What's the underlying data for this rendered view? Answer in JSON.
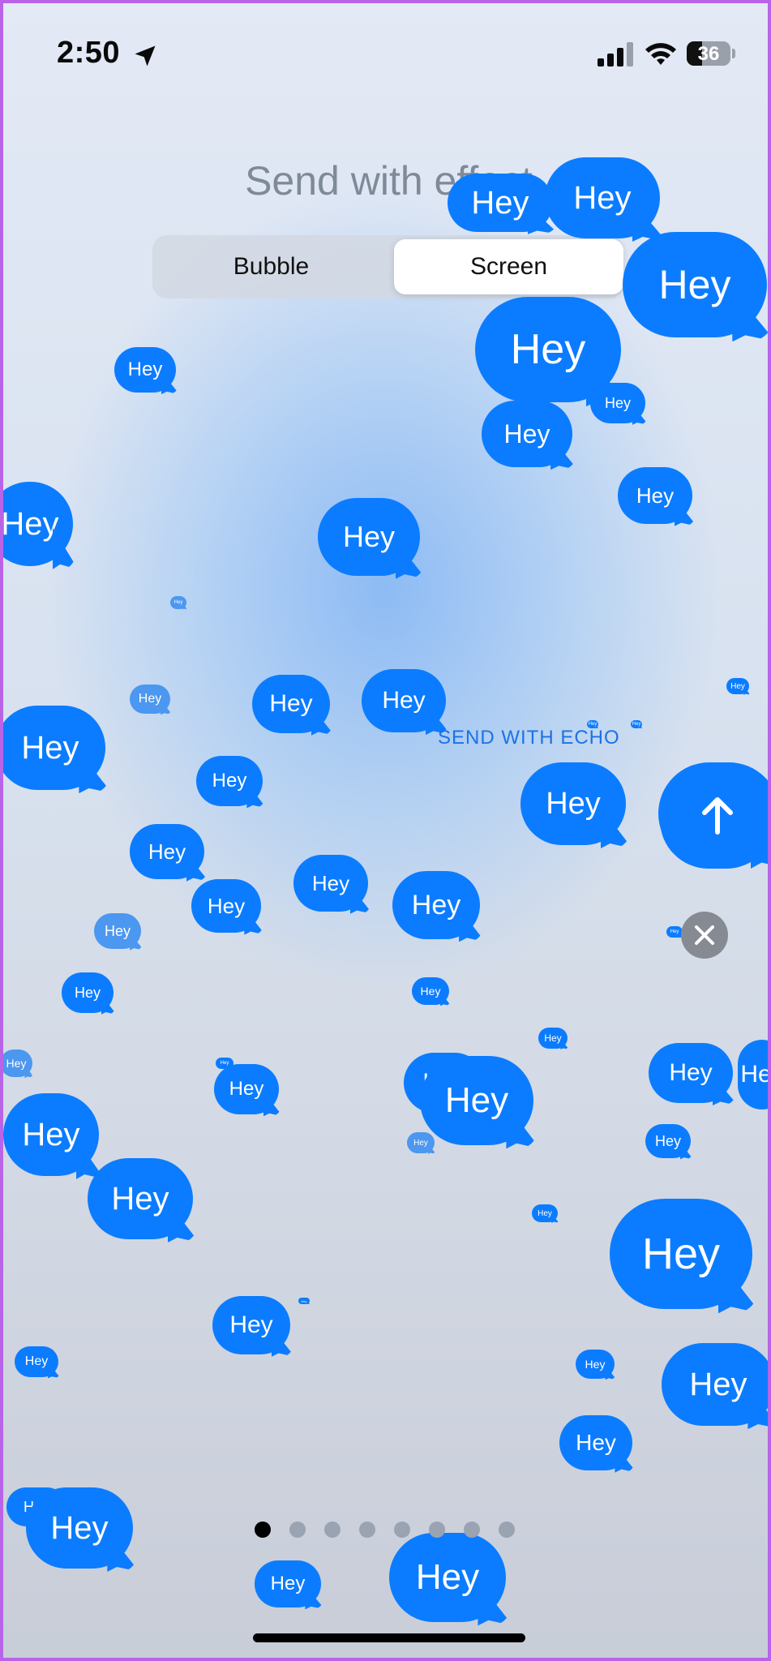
{
  "status_bar": {
    "time": "2:50",
    "battery": "36",
    "battery_level": 0.36
  },
  "title": "Send with effect",
  "segmented": {
    "left_label": "Bubble",
    "right_label": "Screen",
    "selected": "Screen"
  },
  "effect_label": "SEND WITH ECHO",
  "bubble_text": "Hey",
  "icons": {
    "location": "location-arrow-icon",
    "signal": "cellular-signal-icon",
    "wifi": "wifi-icon",
    "send": "arrow-up-icon",
    "close": "close-x-icon"
  },
  "colors": {
    "bubble": "#0b7cff",
    "accent_text": "#1b72e8",
    "title": "#7f8a99"
  },
  "page_indicator": {
    "count": 8,
    "active_index": 0
  }
}
